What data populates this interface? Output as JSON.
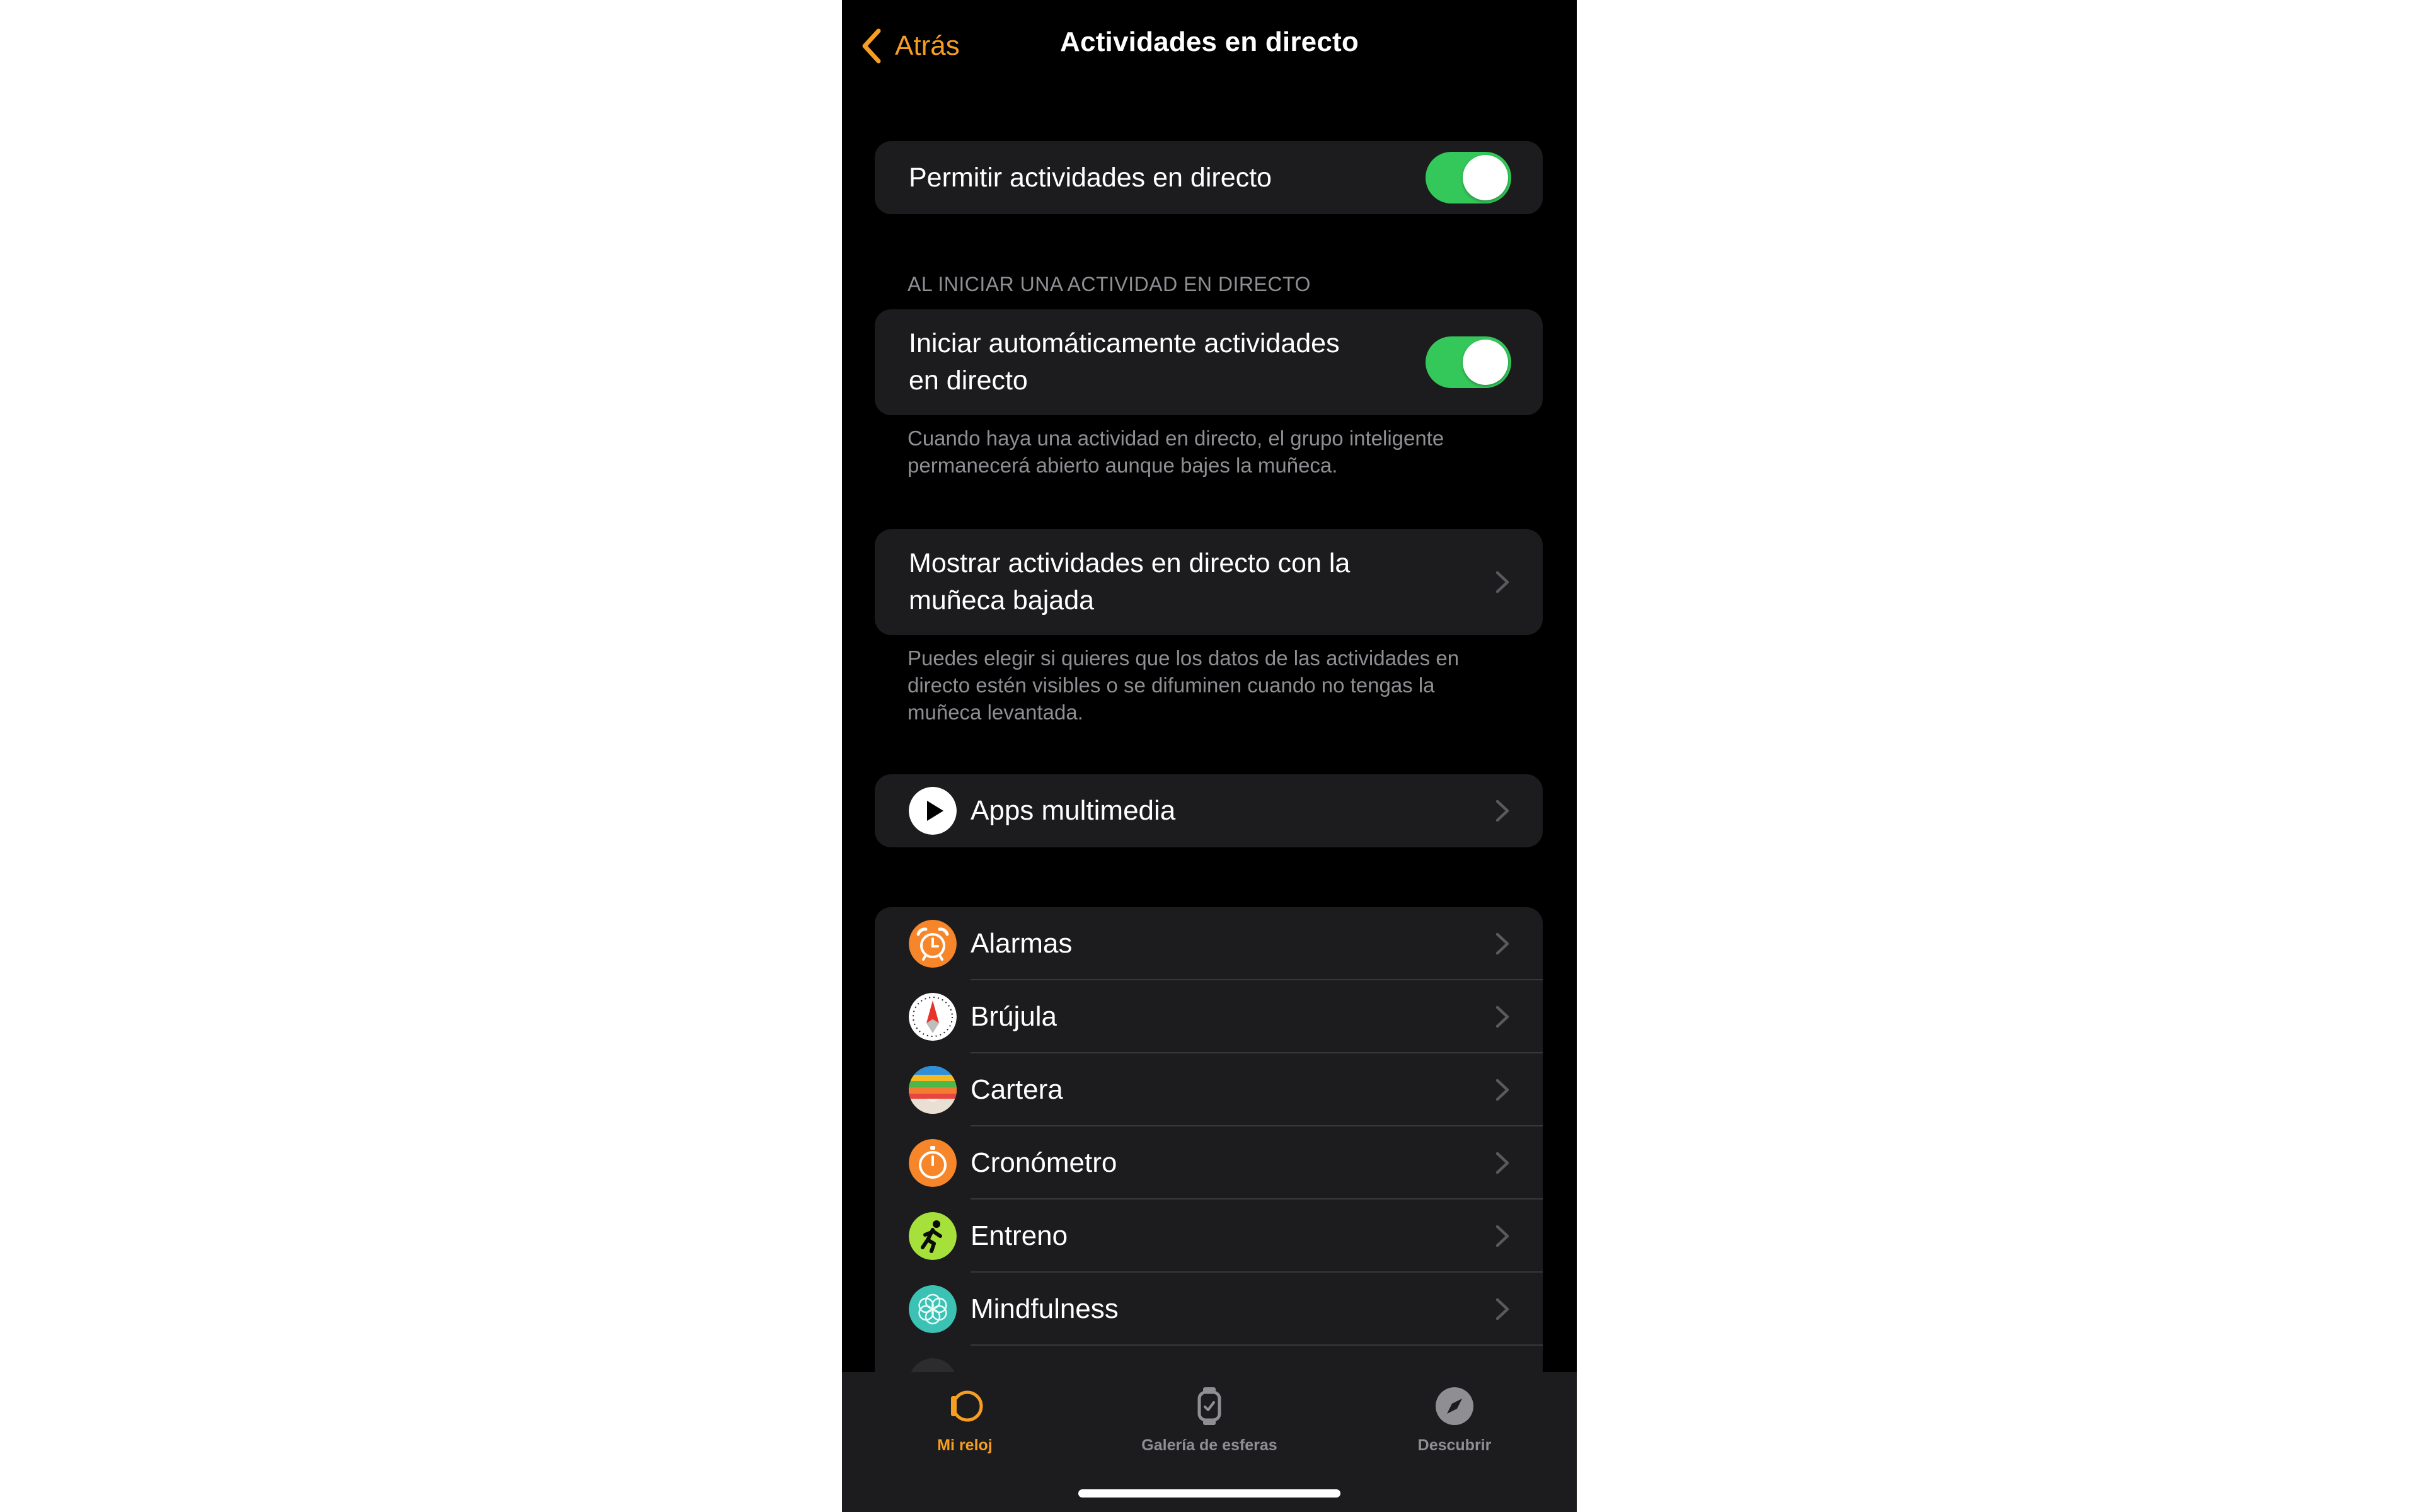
{
  "nav": {
    "back_label": "Atrás",
    "title": "Actividades en directo"
  },
  "allow": {
    "label": "Permitir actividades en directo",
    "enabled": true
  },
  "auto_section": {
    "header": "AL INICIAR UNA ACTIVIDAD EN DIRECTO",
    "label_line1": "Iniciar automáticamente actividades",
    "label_line2": "en directo",
    "enabled": true,
    "caption_line1": "Cuando haya una actividad en directo, el grupo inteligente",
    "caption_line2": "permanecerá abierto aunque bajes la muñeca."
  },
  "wrist": {
    "label_line1": "Mostrar actividades en directo con la",
    "label_line2": "muñeca bajada",
    "caption_line1": "Puedes elegir si quieres que los datos de las actividades en",
    "caption_line2": "directo estén visibles o se difuminen cuando no tengas la",
    "caption_line3": "muñeca levantada."
  },
  "media": {
    "label": "Apps multimedia",
    "icon": "play-icon"
  },
  "apps": [
    {
      "label": "Alarmas",
      "icon": "alarm-clock-icon"
    },
    {
      "label": "Brújula",
      "icon": "compass-icon"
    },
    {
      "label": "Cartera",
      "icon": "wallet-icon"
    },
    {
      "label": "Cronómetro",
      "icon": "stopwatch-icon"
    },
    {
      "label": "Entreno",
      "icon": "workout-runner-icon"
    },
    {
      "label": "Mindfulness",
      "icon": "mindfulness-flower-icon"
    }
  ],
  "tabs": [
    {
      "label": "Mi reloj",
      "icon": "my-watch-icon",
      "active": true
    },
    {
      "label": "Galería de esferas",
      "icon": "watch-face-gallery-icon",
      "active": false
    },
    {
      "label": "Descubrir",
      "icon": "discover-compass-icon",
      "active": false
    }
  ],
  "colors": {
    "accent": "#f59e22",
    "toggle_on": "#34c759",
    "cell_background": "#1c1c1e",
    "secondary_text": "#8e8e93",
    "inactive_tab": "#8e8e93"
  }
}
